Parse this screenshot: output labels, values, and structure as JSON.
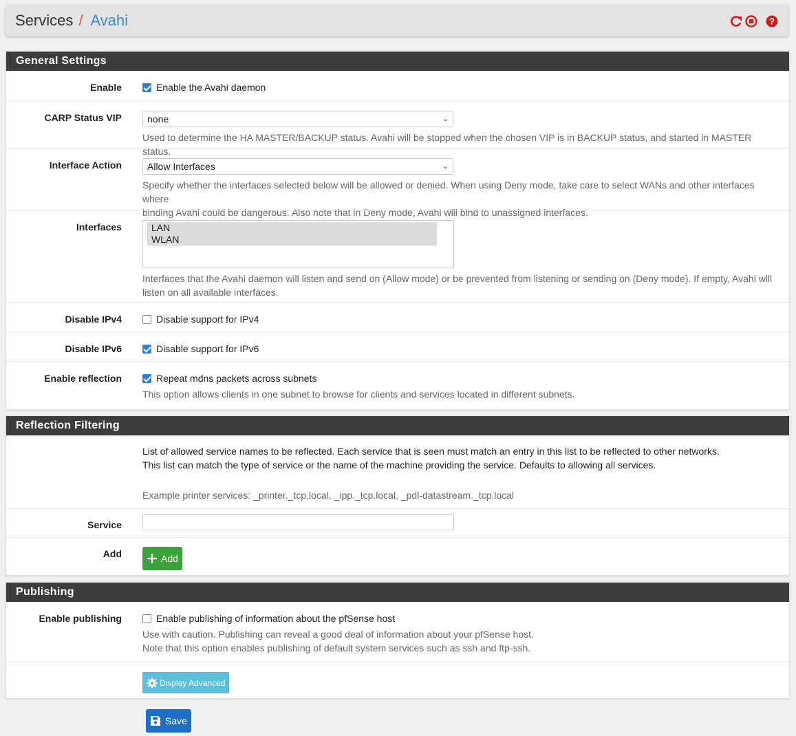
{
  "breadcrumb": {
    "section": "Services",
    "separator": "/",
    "current": "Avahi"
  },
  "header_icons": [
    "restart-icon",
    "stop-icon",
    "help-icon"
  ],
  "general": {
    "heading": "General Settings",
    "enable": {
      "label": "Enable",
      "checkbox_text": "Enable the Avahi daemon",
      "checked": true
    },
    "carp": {
      "label": "CARP Status VIP",
      "value": "none",
      "help": "Used to determine the HA MASTER/BACKUP status. Avahi will be stopped when the chosen VIP is in BACKUP status, and started in MASTER status."
    },
    "interface_action": {
      "label": "Interface Action",
      "value": "Allow Interfaces",
      "help_line1": "Specify whether the interfaces selected below will be allowed or denied. When using Deny mode, take care to select WANs and other interfaces where",
      "help_line2": "binding Avahi could be dangerous. Also note that in Deny mode, Avahi will bind to unassigned interfaces."
    },
    "interfaces": {
      "label": "Interfaces",
      "options": [
        "LAN",
        "WLAN"
      ],
      "help_line1": "Interfaces that the Avahi daemon will listen and send on (Allow mode) or be prevented from listening or sending on (Deny mode). If empty, Avahi will",
      "help_line2": "listen on all available interfaces."
    },
    "disable_ipv4": {
      "label": "Disable IPv4",
      "checkbox_text": "Disable support for IPv4",
      "checked": false
    },
    "disable_ipv6": {
      "label": "Disable IPv6",
      "checkbox_text": "Disable support for IPv6",
      "checked": true
    },
    "reflection": {
      "label": "Enable reflection",
      "checkbox_text": "Repeat mdns packets across subnets",
      "checked": true,
      "help": "This option allows clients in one subnet to browse for clients and services located in different subnets."
    }
  },
  "reflection_filtering": {
    "heading": "Reflection Filtering",
    "info_line1": "List of allowed service names to be reflected. Each service that is seen must match an entry in this list to be reflected to other networks.",
    "info_line2": "This list can match the type of service or the name of the machine providing the service. Defaults to allowing all services.",
    "example": "Example printer services: _printer._tcp.local, _ipp._tcp.local, _pdl-datastream._tcp.local",
    "service_label": "Service",
    "service_value": "",
    "add_label": "Add",
    "add_button": "Add"
  },
  "publishing": {
    "heading": "Publishing",
    "enable": {
      "label": "Enable publishing",
      "checkbox_text": "Enable publishing of information about the pfSense host",
      "checked": false
    },
    "help_line1": "Use with caution. Publishing can reveal a good deal of information about your pfSense host.",
    "help_line2": "Note that this option enables publishing of default system services such as ssh and ftp-ssh.",
    "advanced_button": "Display Advanced"
  },
  "save_button": "Save",
  "colors": {
    "heading_bg": "#3c3c3c",
    "accent_red": "#c9201b",
    "link_blue": "#3f8ac5",
    "add_green": "#3ca03c",
    "save_blue": "#1f6fc7",
    "advanced_cyan": "#5bc0de"
  }
}
